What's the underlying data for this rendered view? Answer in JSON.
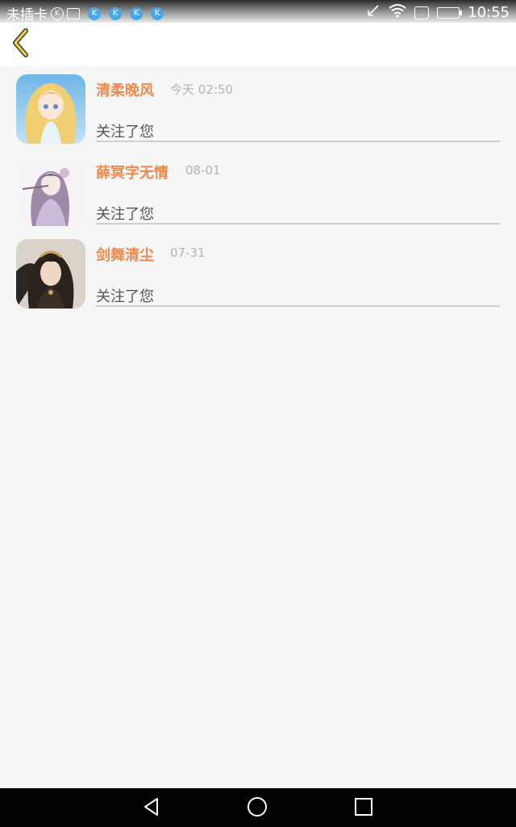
{
  "status_bar": {
    "carrier": "未插卡",
    "k_badges": [
      "K",
      "K",
      "K",
      "K"
    ],
    "time": "10:55"
  },
  "accent_color": "#ee8a4e",
  "messages": [
    {
      "name": "清柔晚风",
      "time": "今天 02:50",
      "text": "关注了您"
    },
    {
      "name": "薛冥字无情",
      "time": "08-01",
      "text": "关注了您"
    },
    {
      "name": "剑舞清尘",
      "time": "07-31",
      "text": "关注了您"
    }
  ]
}
